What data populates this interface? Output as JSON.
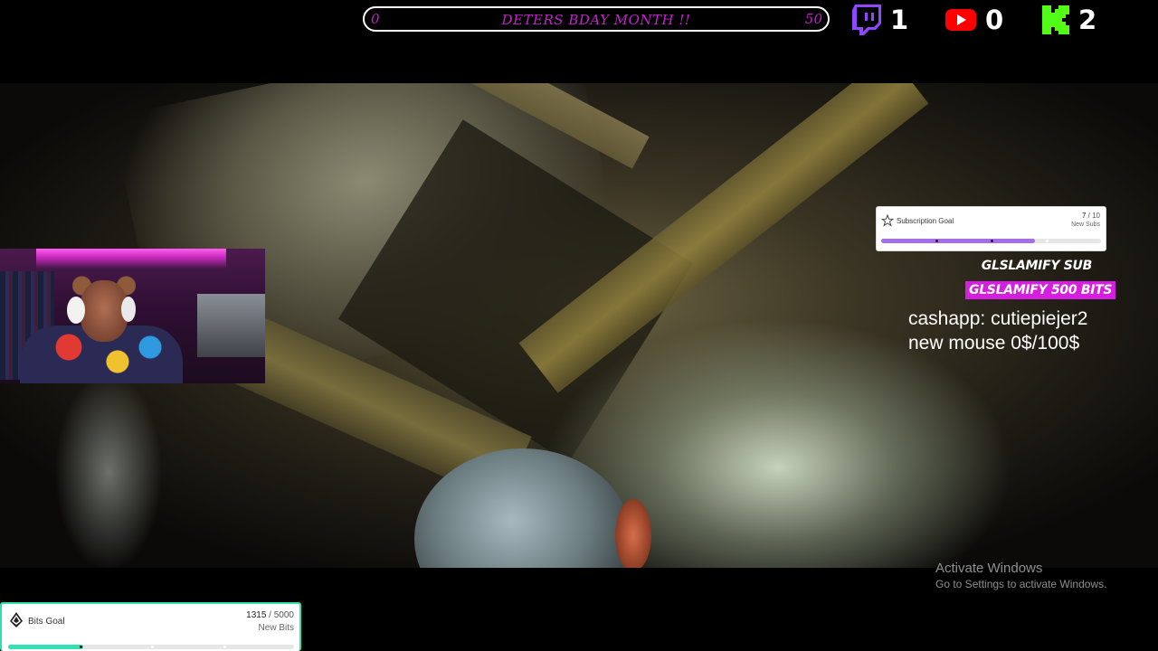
{
  "top_goal": {
    "start_value": "0",
    "title": "DETERS BDAY MONTH !!",
    "end_value": "50",
    "current": 0,
    "target": 50
  },
  "platform_counts": {
    "twitch": {
      "icon": "twitch-icon",
      "color": "#9146ff",
      "count": "1"
    },
    "youtube": {
      "icon": "youtube-icon",
      "color": "#ff0000",
      "count": "0"
    },
    "kick": {
      "icon": "kick-icon",
      "color": "#53fc18",
      "count": "2"
    }
  },
  "subscription_goal": {
    "icon": "star-icon",
    "label": "Subscription Goal",
    "current": "7",
    "separator": " / ",
    "target": "10",
    "unit": "New Subs",
    "fraction": 0.7,
    "bar_color": "#a56ee8"
  },
  "bits_goal": {
    "icon": "bits-icon",
    "label": "Bits Goal",
    "current": "1315",
    "separator": " / ",
    "target": "5000",
    "unit": "New Bits",
    "fraction": 0.263,
    "bar_color": "#35e1b4"
  },
  "alerts": {
    "recent_sub": "GLSLAMIFY  SUB",
    "recent_bits": "GLSLAMIFY  500 BITS",
    "bits_color": "#d51ee0"
  },
  "info": {
    "line1": "cashapp: cutiepiejer2",
    "line2": "new mouse 0$/100$"
  },
  "watermark": {
    "title": "Activate Windows",
    "subtitle": "Go to Settings to activate Windows."
  },
  "accent_color": "#c81fd0"
}
